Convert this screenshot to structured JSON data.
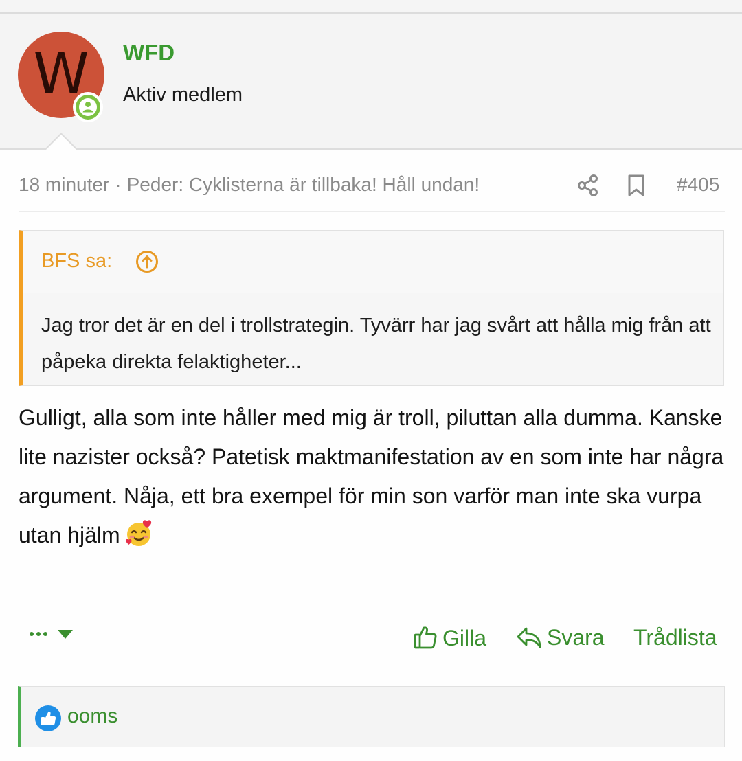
{
  "user": {
    "initial": "W",
    "name": "WFD",
    "title": "Aktiv medlem",
    "avatar_color": "#cc5238",
    "status_icon": "online-user-icon"
  },
  "post": {
    "time": "18 minuter",
    "separator": "·",
    "thread_title": "Peder: Cyklisterna är tillbaka! Håll undan!",
    "number": "#405"
  },
  "quote": {
    "author": "BFS sa:",
    "text": "Jag tror det är en del i trollstrategin. Tyvärr har jag svårt att hålla mig från att påpeka direkta felaktigheter..."
  },
  "message": {
    "text": "Gulligt, alla som inte håller med mig är troll, piluttan alla dumma. Kanske lite nazister också? Patetisk maktmanifestation av en som inte har några argument. Nåja, ett bra exempel för min son varför man inte ska vurpa utan hjälm",
    "emoji": "smiling-face-with-hearts-icon"
  },
  "actions": {
    "like": "Gilla",
    "reply": "Svara",
    "thread_list": "Trådlista"
  },
  "reactions": {
    "user": "ooms",
    "icon": "like-reaction-icon"
  },
  "colors": {
    "accent_green": "#3a9a30",
    "quote_orange": "#f29f22",
    "reaction_blue": "#1f8fe6"
  }
}
